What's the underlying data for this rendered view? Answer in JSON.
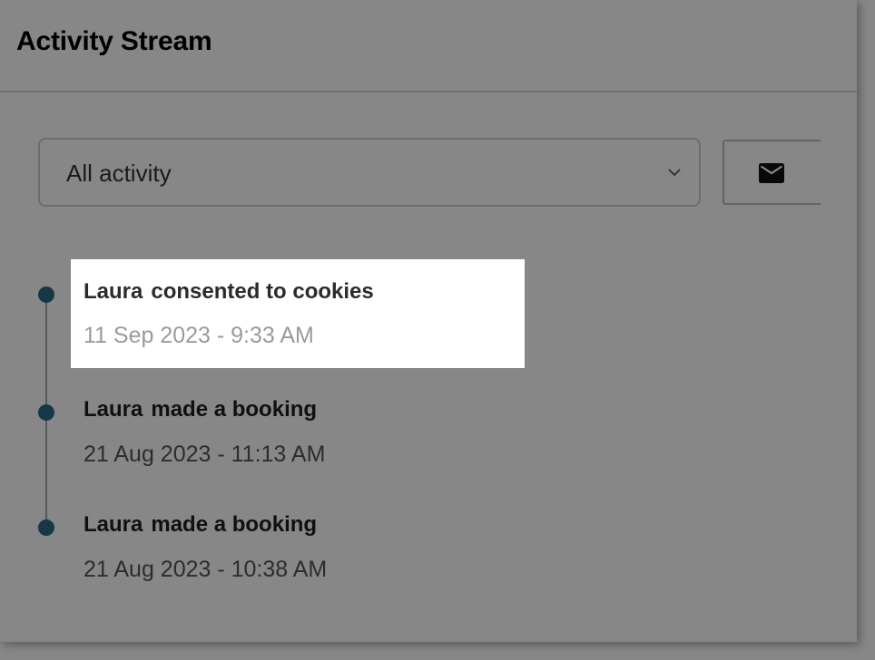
{
  "header": {
    "title": "Activity Stream"
  },
  "filter": {
    "selected": "All activity",
    "icon": "chevron-down-icon"
  },
  "mail_button": {
    "icon": "mail-icon"
  },
  "events": [
    {
      "actor": "Laura",
      "action": "consented to cookies",
      "time": "11 Sep 2023 - 9:33 AM",
      "highlighted": true
    },
    {
      "actor": "Laura",
      "action": "made a booking",
      "time": "21 Aug 2023 - 11:13 AM",
      "highlighted": false
    },
    {
      "actor": "Laura",
      "action": "made a booking",
      "time": "21 Aug 2023 - 10:38 AM",
      "highlighted": false
    }
  ],
  "colors": {
    "timeline_dot": "#2a6b85",
    "overlay": "rgba(0,0,0,0.47)"
  }
}
